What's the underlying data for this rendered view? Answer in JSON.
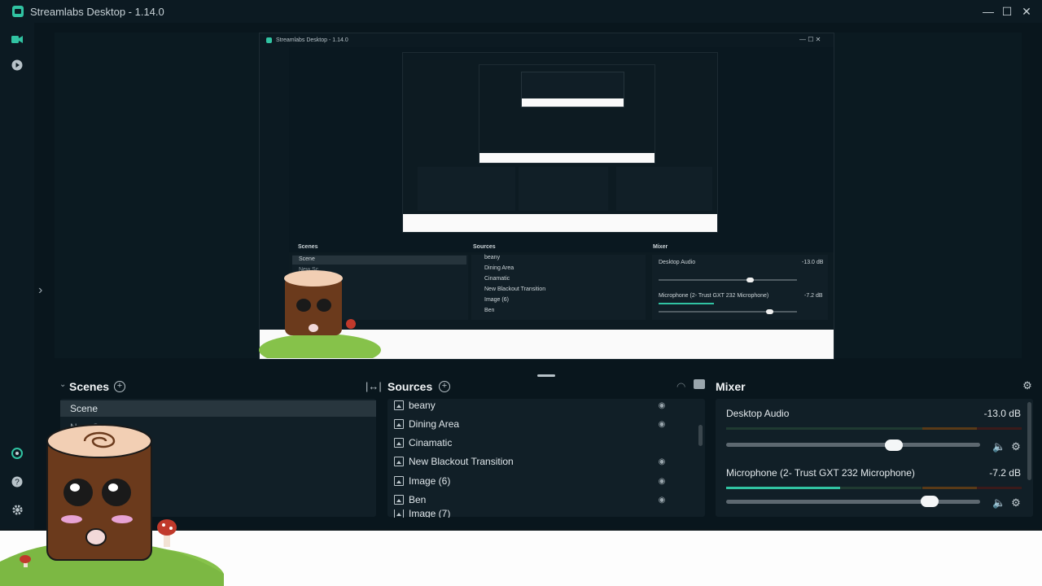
{
  "window": {
    "title": "Streamlabs Desktop - 1.14.0",
    "minimize": "—",
    "maximize": "☐",
    "close": "✕"
  },
  "sidenav": {
    "items": [
      "studio-icon",
      "play-icon"
    ],
    "bottom_items": [
      "cloud-icon",
      "help-icon",
      "gear-icon"
    ]
  },
  "nested_preview": {
    "title": "Streamlabs Desktop - 1.14.0",
    "scenes_title": "Scenes",
    "sources_title": "Sources",
    "mixer_title": "Mixer",
    "scenes": [
      "Scene",
      "New Sc"
    ],
    "sources": [
      "beany",
      "Dining Area",
      "Cinamatic",
      "New Blackout Transition",
      "Image (6)",
      "Ben"
    ],
    "mixer": [
      {
        "name": "Desktop Audio",
        "db": "-13.0 dB"
      },
      {
        "name": "Microphone (2- Trust GXT 232 Microphone)",
        "db": "-7.2 dB"
      }
    ]
  },
  "scenes_panel": {
    "title": "Scenes",
    "items": [
      "Scene",
      "New Sc"
    ]
  },
  "sources_panel": {
    "title": "Sources",
    "items": [
      "beany",
      "Dining Area",
      "Cinamatic",
      "New Blackout Transition",
      "Image (6)",
      "Ben",
      "Image (7)"
    ]
  },
  "mixer_panel": {
    "title": "Mixer",
    "channels": [
      {
        "name": "Desktop Audio",
        "db": "-13.0 dB",
        "level": 0.66
      },
      {
        "name": "Microphone (2- Trust GXT 232 Microphone)",
        "db": "-7.2 dB",
        "level": 0.8
      }
    ]
  },
  "colors": {
    "accent": "#31c3a2",
    "background": "#09161d",
    "panel": "#111f27"
  }
}
